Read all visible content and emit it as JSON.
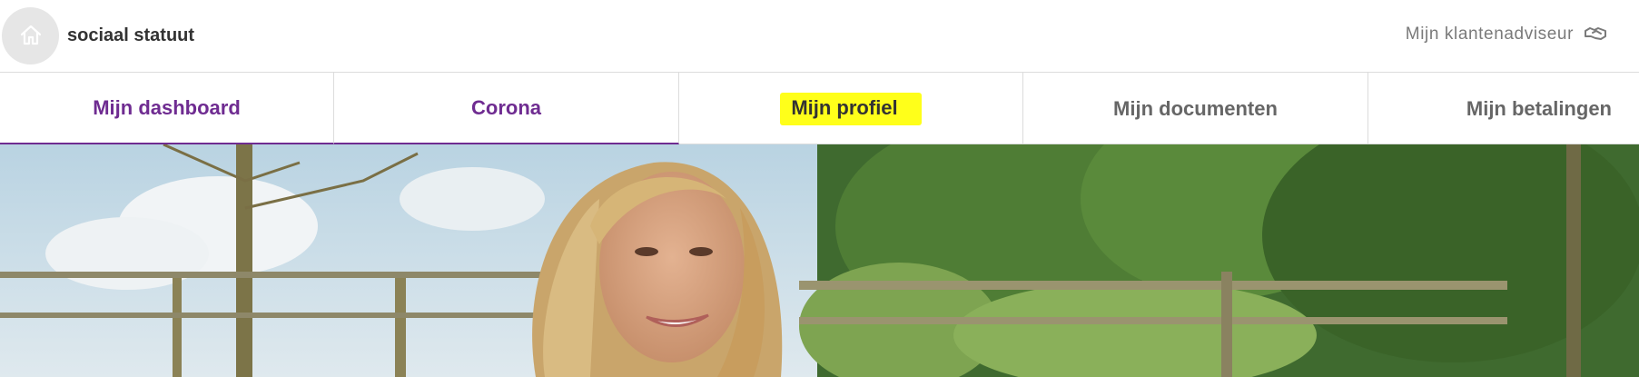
{
  "header": {
    "brand": "sociaal statuut",
    "advisor_label": "Mijn klantenadviseur",
    "icons": {
      "home": "home-icon",
      "advisor": "handshake-icon"
    }
  },
  "nav": {
    "tabs": [
      {
        "label": "Mijn dashboard"
      },
      {
        "label": "Corona"
      },
      {
        "label": "Mijn profiel"
      },
      {
        "label": "Mijn documenten"
      },
      {
        "label": "Mijn betalingen"
      }
    ]
  },
  "colors": {
    "accent": "#6f2c91",
    "highlight": "#ffff1a",
    "tab_text": "#666666",
    "home_circle": "#e6e6e6"
  }
}
